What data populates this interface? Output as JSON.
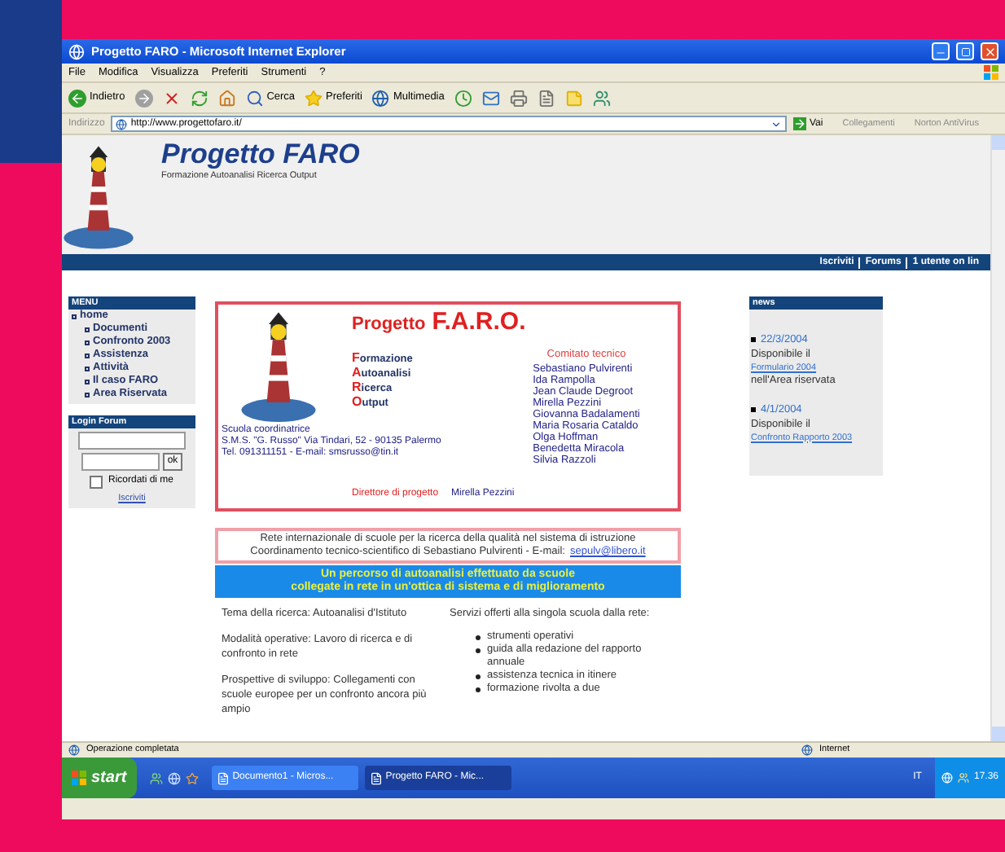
{
  "window": {
    "title": "Progetto FARO - Microsoft Internet Explorer"
  },
  "menu": [
    "File",
    "Modifica",
    "Visualizza",
    "Preferiti",
    "Strumenti",
    "?"
  ],
  "toolbar": [
    {
      "kind": "back",
      "label": "Indietro"
    },
    {
      "kind": "forward"
    },
    {
      "kind": "stop"
    },
    {
      "kind": "refresh"
    },
    {
      "kind": "home"
    },
    {
      "kind": "search",
      "label": "Cerca"
    },
    {
      "kind": "favorites",
      "label": "Preferiti"
    },
    {
      "kind": "media",
      "label": "Multimedia"
    },
    {
      "kind": "history"
    },
    {
      "kind": "mail"
    },
    {
      "kind": "print"
    },
    {
      "kind": "edit"
    },
    {
      "kind": "note"
    },
    {
      "kind": "messenger"
    }
  ],
  "address": {
    "label": "Indirizzo",
    "value": "http://www.progettofaro.it/",
    "go": "Vai",
    "links": "Collegamenti",
    "norton": "Norton AntiVirus"
  },
  "site": {
    "title": "Progetto FARO",
    "subtitle": "Formazione Autoanalisi Ricerca Output",
    "topbar": [
      "Iscriviti",
      "Forums",
      "1 utente on lin"
    ]
  },
  "side_menu": {
    "title": "MENU",
    "items": [
      {
        "label": "home",
        "children": [
          {
            "label": "Documenti"
          },
          {
            "label": "Confronto 2003"
          },
          {
            "label": "Assistenza"
          },
          {
            "label": "Attività"
          },
          {
            "label": "Il caso FARO"
          },
          {
            "label": "Area Riservata"
          }
        ]
      }
    ]
  },
  "login": {
    "title": "Login Forum",
    "button": "ok",
    "remember": "Ricordati di me",
    "checked": false,
    "link": "Iscriviti"
  },
  "card": {
    "title": "Progetto",
    "title_highlight": "F.A.R.O.",
    "acronym": [
      {
        "initial": "F",
        "rest": "ormazione"
      },
      {
        "initial": "A",
        "rest": "utoanalisi"
      },
      {
        "initial": "R",
        "rest": "icerca"
      },
      {
        "initial": "O",
        "rest": "utput"
      }
    ],
    "committee_title": "Comitato tecnico",
    "committee": [
      "Sebastiano Pulvirenti",
      "Ida Rampolla",
      "Jean Claude Degroot",
      "Mirella Pezzini",
      "Giovanna Badalamenti",
      "Maria Rosaria Cataldo",
      "Olga Hoffman",
      "Benedetta Miracola",
      "Silvia Razzoli"
    ],
    "school": [
      "Scuola coordinatrice",
      "S.M.S. \"G. Russo\" Via Tindari, 52 - 90135 Palermo",
      "Tel. 091311151  -  E-mail: smsrusso@tin.it"
    ],
    "director_label": "Direttore di progetto",
    "director": "Mirella Pezzini"
  },
  "network": {
    "line1": "Rete internazionale di scuole per la ricerca della qualità nel sistema di istruzione",
    "line2": "Coordinamento tecnico-scientifico di Sebastiano Pulvirenti - E-mail:",
    "email": "sepulv@libero.it"
  },
  "banner": [
    "Un percorso di autoanalisi effettuato da scuole",
    "collegate in rete in un'ottica di sistema e di miglioramento"
  ],
  "left_text": [
    "Tema della ricerca: Autoanalisi d'Istituto",
    "Modalità operative: Lavoro di ricerca e di confronto in rete",
    "Prospettive di sviluppo: Collegamenti con scuole europee per un confronto ancora più ampio"
  ],
  "services": {
    "intro": "Servizi offerti alla singola scuola dalla rete:",
    "items": [
      "strumenti operativi",
      "guida alla redazione del rapporto annuale",
      "assistenza tecnica in itinere",
      "formazione rivolta a due"
    ]
  },
  "news": {
    "title": "news",
    "items": [
      {
        "date": "22/3/2004",
        "pre": "Disponibile il",
        "link": "Formulario 2004",
        "post": "nell'Area riservata"
      },
      {
        "date": "4/1/2004",
        "pre": "Disponibile il",
        "link": "Confronto Rapporto 2003"
      }
    ]
  },
  "status": {
    "text": "Operazione completata",
    "zone": "Internet"
  },
  "taskbar": {
    "start": "start",
    "tasks": [
      {
        "label": "Documento1 - Micros...",
        "selected": false
      },
      {
        "label": "Progetto FARO - Mic...",
        "selected": true
      }
    ],
    "lang": "IT",
    "clock": "17.36"
  }
}
